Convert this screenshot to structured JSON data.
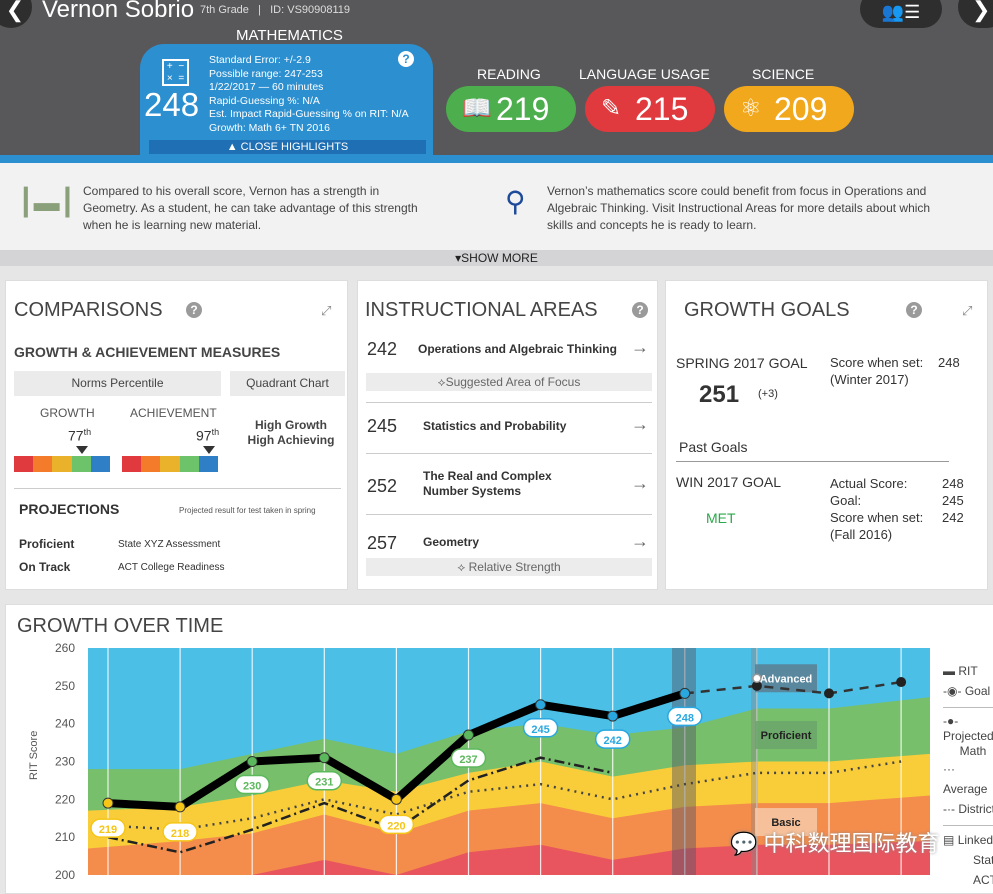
{
  "header": {
    "back_icon": "chevron-left",
    "student_name": "Vernon Sobrio",
    "grade": "7th Grade",
    "separator": "|",
    "student_id": "ID: VS90908119",
    "menu_icon": "user-list",
    "forward_icon": "chevron-right"
  },
  "math": {
    "label": "MATHEMATICS",
    "score": "248",
    "icon": "calculator",
    "details": [
      "Standard Error: +/-2.9",
      "Possible range: 247-253",
      "1/22/2017 — 60 minutes",
      "Rapid-Guessing %: N/A",
      "Est. Impact Rapid-Guessing % on RIT: N/A",
      "Growth: Math 6+ TN 2016"
    ],
    "close": "▲ CLOSE HIGHLIGHTS",
    "help": "?"
  },
  "subjects": [
    {
      "label": "READING",
      "score": "219",
      "color": "#4cae4c",
      "icon": "book"
    },
    {
      "label": "LANGUAGE USAGE",
      "score": "215",
      "color": "#e03a3e",
      "icon": "pencil"
    },
    {
      "label": "SCIENCE",
      "score": "209",
      "color": "#f2a81d",
      "icon": "atom"
    }
  ],
  "banner": {
    "strength": "Compared to his overall score, Vernon has a strength in Geometry. As a student, he can take advantage of this strength when he is learning new material.",
    "focus": "Vernon’s mathematics score could benefit from focus in Operations and Algebraic Thinking. Visit Instructional Areas for more details about which skills and concepts he is ready to learn.",
    "show_more": "▾SHOW MORE"
  },
  "comparisons": {
    "title": "COMPARISONS",
    "subtitle": "GROWTH & ACHIEVEMENT MEASURES",
    "tab_norms": "Norms Percentile",
    "tab_quadrant": "Quadrant Chart",
    "growth_label": "GROWTH",
    "growth_pct": "77",
    "achievement_label": "ACHIEVEMENT",
    "achievement_pct": "97",
    "suffix": "th",
    "growth_percentile": 77,
    "achievement_percentile": 97,
    "quadrant": "High Growth High Achieving",
    "bar_colors": [
      "#e03a3e",
      "#f47b2a",
      "#eab12a",
      "#6cc36a",
      "#2f7fc6"
    ],
    "projections_title": "PROJECTIONS",
    "projections_note": "Projected result for test taken in spring",
    "projections": [
      {
        "status": "Proficient",
        "test": "State XYZ Assessment"
      },
      {
        "status": "On Track",
        "test": "ACT College Readiness"
      }
    ]
  },
  "instructional": {
    "title": "INSTRUCTIONAL AREAS",
    "areas": [
      {
        "score": "242",
        "name": "Operations and Algebraic Thinking",
        "tag": "Suggested Area of Focus"
      },
      {
        "score": "245",
        "name": "Statistics and Probability"
      },
      {
        "score": "252",
        "name": "The Real and Complex Number Systems"
      },
      {
        "score": "257",
        "name": "Geometry",
        "tag": "Relative Strength"
      }
    ]
  },
  "goals": {
    "title": "GROWTH GOALS",
    "spring_label": "SPRING 2017 GOAL",
    "spring_goal": "251",
    "spring_delta": "(+3)",
    "score_when_set_label": "Score when set:",
    "score_when_set": "248",
    "score_when_set_term": "(Winter 2017)",
    "past_title": "Past Goals",
    "win_label": "WIN 2017 GOAL",
    "win_status": "MET",
    "actual_label": "Actual Score:",
    "actual": "248",
    "goal_label": "Goal:",
    "goal": "245",
    "set_label": "Score when set:",
    "set": "242",
    "set_term": "(Fall 2016)"
  },
  "chart_data": {
    "type": "area",
    "title": "GROWTH OVER TIME",
    "ylabel": "RIT Score",
    "ylim": [
      200,
      260
    ],
    "yticks": [
      200,
      210,
      220,
      230,
      240,
      250,
      260
    ],
    "grid": true,
    "rit": {
      "values": [
        219,
        218,
        230,
        231,
        220,
        237,
        245,
        242,
        248
      ],
      "labels": [
        "219",
        "218",
        "230",
        "231",
        "220",
        "237",
        "245",
        "242",
        "248"
      ],
      "label_colors": [
        "#f5c518",
        "#f5c518",
        "#5cb85c",
        "#5cb85c",
        "#f5c518",
        "#5cb85c",
        "#29a8e0",
        "#29a8e0",
        "#29a8e0"
      ]
    },
    "projected": [
      null,
      null,
      null,
      null,
      null,
      null,
      null,
      null,
      248,
      250,
      248,
      251
    ],
    "goal_point": {
      "index": 9,
      "value": 252
    },
    "average": [
      213,
      212,
      215,
      220,
      216,
      222,
      224,
      220,
      224,
      227,
      227,
      230
    ],
    "district": [
      210,
      206,
      212,
      219,
      212,
      225,
      231,
      227
    ],
    "bands": [
      {
        "name": "Basic",
        "color": "#e8555e",
        "top": [
          199,
          199,
          200,
          204,
          200,
          206,
          208,
          204,
          207,
          208,
          208,
          209
        ]
      },
      {
        "color": "#f48c4c",
        "top": [
          207,
          209,
          211,
          216,
          211,
          217,
          219,
          215,
          218,
          219,
          219,
          221
        ]
      },
      {
        "color": "#f9cd3a",
        "top": [
          217,
          218,
          221,
          225,
          222,
          227,
          230,
          226,
          229,
          230,
          230,
          232
        ]
      },
      {
        "name": "Proficient",
        "color": "#77bf6a",
        "top": [
          228,
          228,
          232,
          236,
          232,
          238,
          240,
          237,
          239,
          244,
          244,
          247
        ]
      },
      {
        "name": "Advanced",
        "color": "#4bbfe6",
        "top": [
          260,
          260,
          260,
          260,
          260,
          260,
          260,
          260,
          260,
          260,
          260,
          260
        ]
      }
    ],
    "band_labels": [
      "Advanced",
      "Proficient",
      "Basic"
    ],
    "legend": [
      "RIT",
      "Goal",
      "Projected",
      "Math",
      "Average",
      "District",
      "Linked",
      "State",
      "ACT"
    ]
  },
  "watermark": "中科数理国际教育"
}
